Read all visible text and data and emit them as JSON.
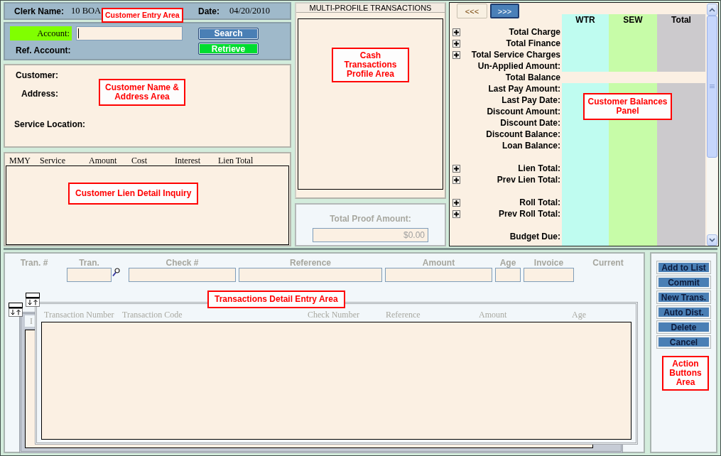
{
  "clerk_bar": {
    "clerk_label": "Clerk Name:",
    "clerk_value": "10 BOA",
    "date_label": "Date:",
    "date_value": "04/20/2010",
    "callout": "Customer Entry Area"
  },
  "account_bar": {
    "account_label": "Account:",
    "highlighted": true,
    "focused": true,
    "ref_label": "Ref. Account:",
    "buttons": [
      {
        "label": "Search",
        "kind": "search"
      },
      {
        "label": "Retrieve",
        "kind": "retrieve"
      }
    ]
  },
  "customer_panel": {
    "fields": [
      {
        "label": "Customer:"
      },
      {
        "label": "Address:"
      },
      {
        "label": "Service Location:"
      }
    ],
    "callout": "Customer Name & Address Area"
  },
  "lien_panel": {
    "columns": [
      "MMY",
      "Service",
      "Amount",
      "Cost",
      "Interest",
      "Lien Total"
    ],
    "callout": "Customer Lien Detail Inquiry"
  },
  "profile_panel": {
    "title": "MULTI-PROFILE TRANSACTIONS",
    "callout": "Cash Transactions Profile Area"
  },
  "proof_panel": {
    "label": "Total Proof Amount:",
    "value": "$0.00",
    "disabled": true
  },
  "balances_panel": {
    "nav": [
      {
        "label": "<<<",
        "selected": false
      },
      {
        "label": ">>>",
        "selected": true
      }
    ],
    "columns": [
      {
        "label": "WTR",
        "color": "#bffcf0"
      },
      {
        "label": "SEW",
        "color": "#c7fca8"
      },
      {
        "label": "Total",
        "color": "#cccacd"
      }
    ],
    "rows": [
      {
        "label": "Total Charge",
        "kind": "group"
      },
      {
        "label": "Total Finance",
        "kind": "group"
      },
      {
        "label": "Total Service Charges",
        "kind": "group"
      },
      {
        "label": "Un-Applied Amount:",
        "kind": "field"
      },
      {
        "label": "Total Balance",
        "kind": "total"
      },
      {
        "label": "Last Pay Amount:",
        "kind": "field"
      },
      {
        "label": "Last Pay Date:",
        "kind": "field"
      },
      {
        "label": "Discount Amount:",
        "kind": "field"
      },
      {
        "label": "Discount Date:",
        "kind": "field"
      },
      {
        "label": "Discount Balance:",
        "kind": "field"
      },
      {
        "label": "Loan Balance:",
        "kind": "field"
      },
      {
        "kind": "spacer"
      },
      {
        "label": "Lien Total:",
        "kind": "group"
      },
      {
        "label": "Prev Lien Total:",
        "kind": "group"
      },
      {
        "kind": "spacer"
      },
      {
        "label": "Roll Total:",
        "kind": "group"
      },
      {
        "label": "Prev Roll Total:",
        "kind": "group"
      },
      {
        "kind": "spacer"
      },
      {
        "label": "Budget Due:",
        "kind": "field"
      }
    ],
    "callout": "Customer Balances Panel"
  },
  "entry_panel": {
    "disabled": true,
    "fields": [
      {
        "label": "Tran. #",
        "kind": "label"
      },
      {
        "label": "Tran.",
        "kind": "lookup"
      },
      {
        "label": "Check #",
        "kind": "input"
      },
      {
        "label": "Reference",
        "kind": "input"
      },
      {
        "label": "Amount",
        "kind": "input"
      },
      {
        "label": "Age",
        "kind": "input"
      },
      {
        "label": "Invoice",
        "kind": "input"
      },
      {
        "label": "Current",
        "kind": "label"
      }
    ],
    "back_list_header": "I",
    "list_columns": [
      "Transaction Number",
      "Transaction Code",
      "Check Number",
      "Reference",
      "Amount",
      "Age"
    ],
    "callout": "Transactions Detail Entry Area"
  },
  "action_panel": {
    "buttons": [
      {
        "label": "Add to List"
      },
      {
        "label": "Commit"
      },
      {
        "label": "New Trans."
      },
      {
        "label": "Auto Dist."
      },
      {
        "label": "Delete"
      },
      {
        "label": "Cancel"
      }
    ],
    "callout": "Action Buttons Area"
  }
}
